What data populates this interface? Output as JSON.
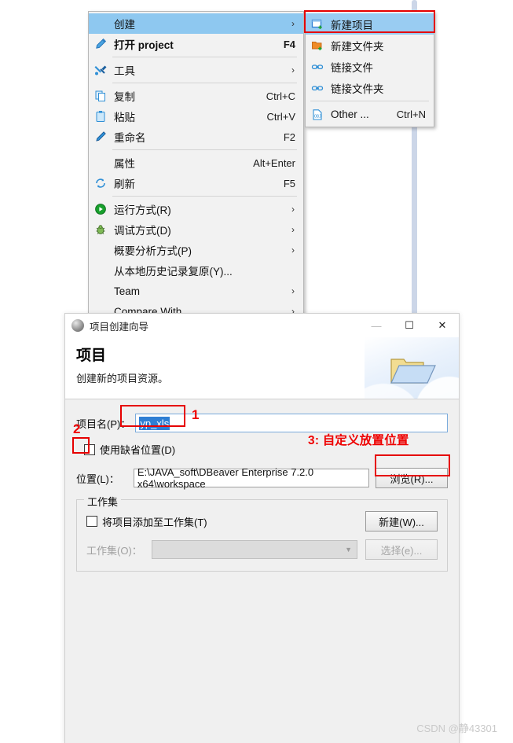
{
  "context_menu": {
    "items": [
      {
        "label": "创建",
        "accel": "",
        "arrow": "›",
        "icon": "",
        "selected": true
      },
      {
        "label": "打开 project",
        "accel": "F4",
        "arrow": "",
        "icon": "pencil-icon",
        "bold_accel": true
      },
      {
        "label": "工具",
        "accel": "",
        "arrow": "›",
        "icon": "tools-icon"
      },
      {
        "label": "复制",
        "accel": "Ctrl+C",
        "arrow": "",
        "icon": "copy-icon"
      },
      {
        "label": "粘贴",
        "accel": "Ctrl+V",
        "arrow": "",
        "icon": "paste-icon"
      },
      {
        "label": "重命名",
        "accel": "F2",
        "arrow": "",
        "icon": "rename-pencil-icon"
      },
      {
        "label": "属性",
        "accel": "Alt+Enter",
        "arrow": "",
        "icon": ""
      },
      {
        "label": "刷新",
        "accel": "F5",
        "arrow": "",
        "icon": "refresh-icon"
      },
      {
        "label": "运行方式(R)",
        "accel": "",
        "arrow": "›",
        "icon": "run-play-icon"
      },
      {
        "label": "调试方式(D)",
        "accel": "",
        "arrow": "›",
        "icon": "debug-bug-icon"
      },
      {
        "label": "概要分析方式(P)",
        "accel": "",
        "arrow": "›",
        "icon": ""
      },
      {
        "label": "从本地历史记录复原(Y)...",
        "accel": "",
        "arrow": "",
        "icon": ""
      },
      {
        "label": "Team",
        "accel": "",
        "arrow": "›",
        "icon": ""
      },
      {
        "label": "Compare With",
        "accel": "",
        "arrow": "›",
        "icon": ""
      }
    ]
  },
  "submenu": {
    "items": [
      {
        "label": "新建项目",
        "accel": "",
        "icon": "new-project-icon",
        "selected": true
      },
      {
        "label": "新建文件夹",
        "accel": "",
        "icon": "new-folder-icon"
      },
      {
        "label": "链接文件",
        "accel": "",
        "icon": "link-file-icon"
      },
      {
        "label": "链接文件夹",
        "accel": "",
        "icon": "link-folder-icon"
      },
      {
        "label": "Other ...",
        "accel": "Ctrl+N",
        "icon": "other-obj-icon"
      }
    ]
  },
  "dialog": {
    "title": "项目创建向导",
    "heading": "项目",
    "subtitle": "创建新的项目资源。",
    "window_controls": {
      "minimize": "—",
      "maximize": "☐",
      "close": "✕"
    },
    "project_name_label": "项目名(P)：",
    "project_name_value": "yp_xls",
    "use_default_location_label": "使用缺省位置(D)",
    "use_default_location_checked": false,
    "location_label": "位置(L)：",
    "location_value": "E:\\JAVA_soft\\DBeaver Enterprise 7.2.0 x64\\workspace",
    "browse_button": "浏览(R)...",
    "workingset": {
      "group_title": "工作集",
      "add_label": "将项目添加至工作集(T)",
      "add_checked": false,
      "new_button": "新建(W)...",
      "combo_label": "工作集(O)：",
      "combo_value": "",
      "select_button": "选择(e)..."
    }
  },
  "annotations": {
    "one": "1",
    "two": "2",
    "three": "3: 自定义放置位置"
  },
  "watermark": "CSDN @静43301",
  "colors": {
    "menu_highlight": "#8ec8f0",
    "annotation_red": "#ee0000",
    "selection_blue": "#2f7fd4",
    "field_border_focus": "#7aabdc"
  }
}
